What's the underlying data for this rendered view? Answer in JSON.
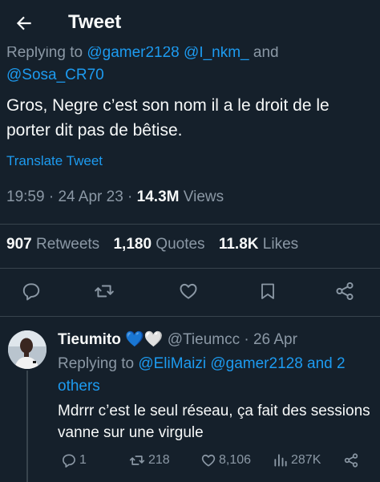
{
  "header": {
    "title": "Tweet",
    "back_icon": "arrow-left-icon"
  },
  "tweet": {
    "replying_prefix": "Replying to ",
    "replying_mentions": "@gamer2128 @I_nkm_",
    "replying_and": " and ",
    "replying_last": "@Sosa_CR70",
    "text": "Gros, Negre c’est son nom il a le droit de le porter dit pas de bêtise.",
    "translate": "Translate Tweet",
    "time": "19:59",
    "sep1": " · ",
    "date": "24 Apr 23",
    "sep2": " · ",
    "views_count": "14.3M",
    "views_label": " Views",
    "retweets_count": "907",
    "retweets_label": "Retweets",
    "quotes_count": "1,180",
    "quotes_label": "Quotes",
    "likes_count": "11.8K",
    "likes_label": "Likes"
  },
  "reply": {
    "name": "Tieumito",
    "name_emoji": "💙🤍",
    "handle": "@Tieumcc",
    "sep": " · ",
    "date": "26 Apr",
    "replying_prefix": "Replying to ",
    "replying_mentions": "@EliMaizi @gamer2128 and 2 others",
    "text": "Mdrrr c’est le seul réseau, ça fait des sessions vanne sur une virgule",
    "replies": "1",
    "retweets": "218",
    "likes": "8,106",
    "views": "287K"
  },
  "colors": {
    "background": "#15202b",
    "accent": "#1d9bf0",
    "secondary_text": "#8b98a5",
    "primary_text": "#f7f9f9",
    "divider": "#38444d"
  }
}
